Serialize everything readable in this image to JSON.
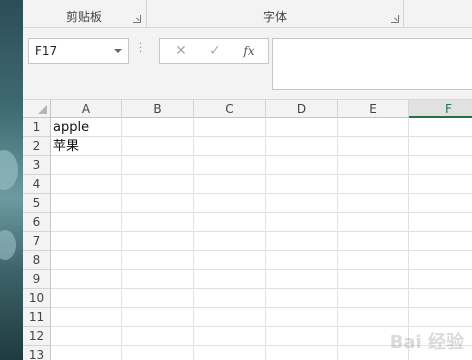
{
  "ribbon": {
    "clipboard_label": "剪贴板",
    "font_label": "字体"
  },
  "formula_bar": {
    "name_box": "F17",
    "cancel_icon": "✕",
    "enter_icon": "✓",
    "fx_label": "fx",
    "formula_value": ""
  },
  "sheet": {
    "columns": [
      "A",
      "B",
      "C",
      "D",
      "E",
      "F"
    ],
    "selected_column": "F",
    "rows": [
      "1",
      "2",
      "3",
      "4",
      "5",
      "6",
      "7",
      "8",
      "9",
      "10",
      "11",
      "12",
      "13"
    ],
    "cells": {
      "A1": "apple",
      "A2": "苹果"
    }
  },
  "watermark": "Bai 经验"
}
